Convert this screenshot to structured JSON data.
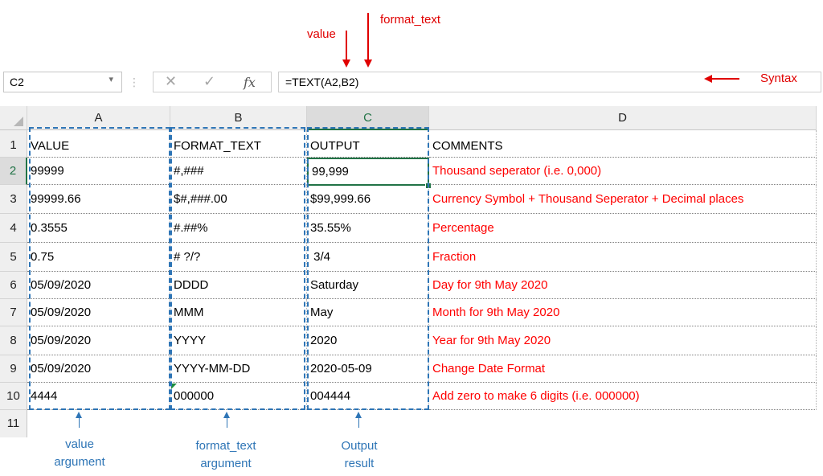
{
  "annotations": {
    "value": "value",
    "format_text": "format_text",
    "syntax": "Syntax",
    "value_argument": [
      "value",
      "argument"
    ],
    "format_text_argument": [
      "format_text",
      "argument"
    ],
    "output_result": [
      "Output",
      "result"
    ]
  },
  "formula_bar": {
    "name_box": "C2",
    "formula": "=TEXT(A2,B2)",
    "fx_label": "fx"
  },
  "columns": [
    "A",
    "B",
    "C",
    "D"
  ],
  "rows": [
    {
      "num": "1",
      "a": "VALUE",
      "b": "FORMAT_TEXT",
      "c": "OUTPUT",
      "d": "COMMENTS"
    },
    {
      "num": "2",
      "a": "99999",
      "b": "#,###",
      "c": "99,999",
      "d": "Thousand seperator (i.e. 0,000)"
    },
    {
      "num": "3",
      "a": "99999.66",
      "b": "$#,###.00",
      "c": "$99,999.66",
      "d": "Currency Symbol + Thousand Seperator + Decimal places"
    },
    {
      "num": "4",
      "a": "0.3555",
      "b": "#.##%",
      "c": "35.55%",
      "d": "Percentage"
    },
    {
      "num": "5",
      "a": "0.75",
      "b": "# ?/?",
      "c": " 3/4",
      "d": "Fraction"
    },
    {
      "num": "6",
      "a": "05/09/2020",
      "b": "DDDD",
      "c": "Saturday",
      "d": "Day for 9th May 2020"
    },
    {
      "num": "7",
      "a": "05/09/2020",
      "b": "MMM",
      "c": "May",
      "d": "Month for 9th May 2020"
    },
    {
      "num": "8",
      "a": "05/09/2020",
      "b": "YYYY",
      "c": "2020",
      "d": "Year for 9th May 2020"
    },
    {
      "num": "9",
      "a": "05/09/2020",
      "b": "YYYY-MM-DD",
      "c": "2020-05-09",
      "d": "Change Date Format"
    },
    {
      "num": "10",
      "a": "4444",
      "b": "000000",
      "c": "004444",
      "d": "Add zero to make 6 digits (i.e. 000000)"
    },
    {
      "num": "11",
      "a": "",
      "b": "",
      "c": "",
      "d": ""
    }
  ],
  "colors": {
    "excel_green": "#217346",
    "annotation_red": "#e00000",
    "comment_red": "#ff0000",
    "annotation_blue": "#2e75b6"
  }
}
